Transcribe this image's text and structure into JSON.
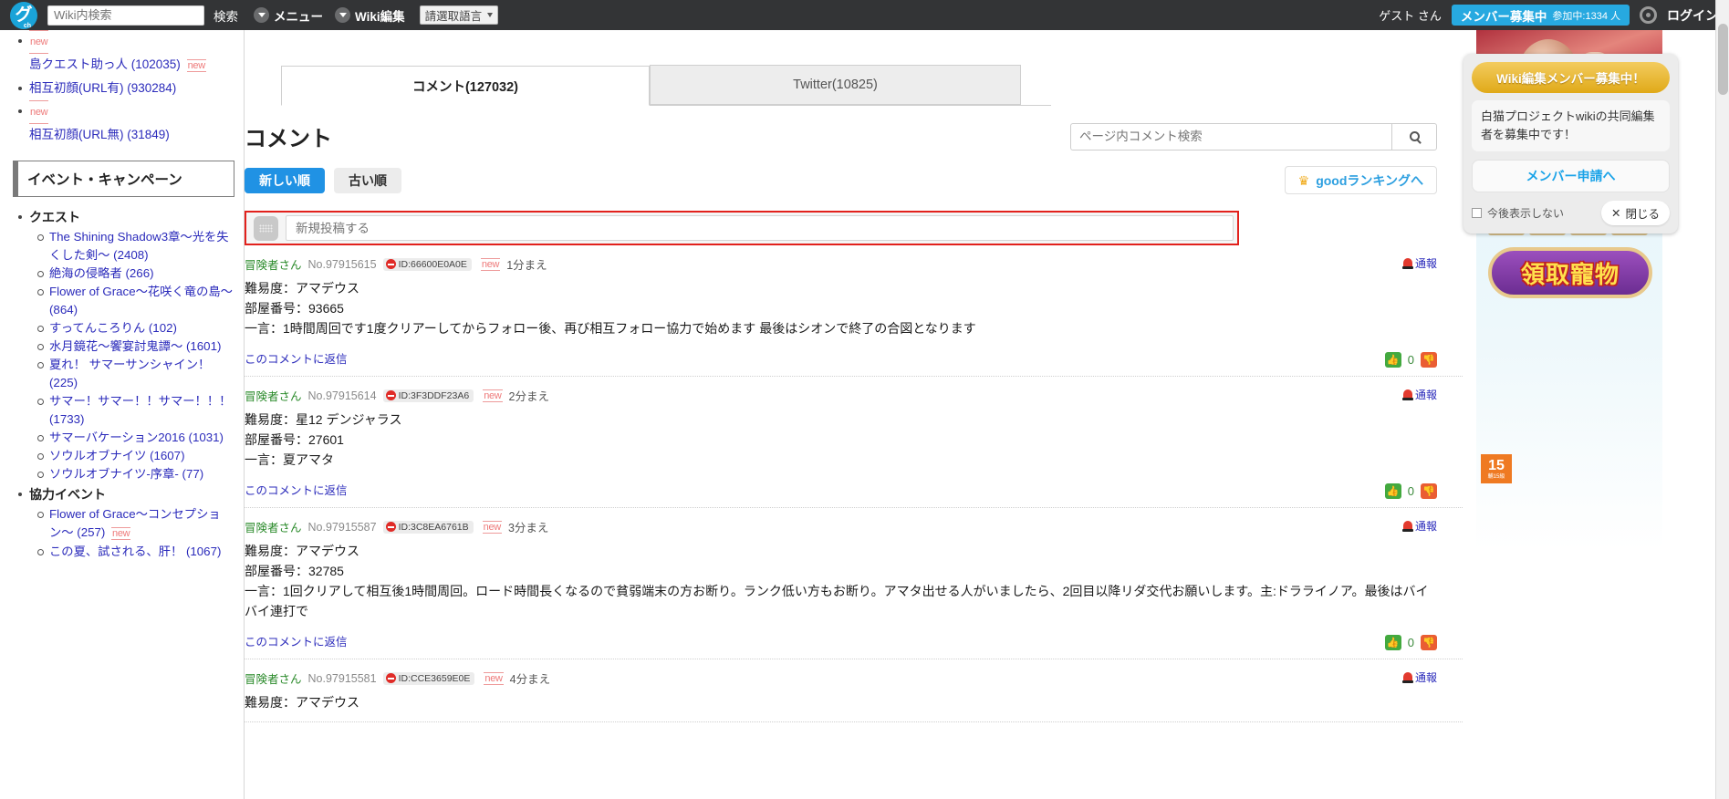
{
  "topbar": {
    "logo_text": "グ",
    "logo_sub": "ch",
    "search_placeholder": "Wiki内検索",
    "search_value": "",
    "search_button": "検索",
    "menu_label": "メニュー",
    "wiki_edit_label": "Wiki編集",
    "language_selected": "請選取語言",
    "guest_label": "ゲスト さん",
    "member_badge_title": "メンバー募集中",
    "member_badge_count": "参加中:1334 人",
    "login_label": "ログイン",
    "icons": {
      "menu_caret": "chevron-down-icon",
      "wiki_caret": "chevron-down-icon",
      "gear": "gear-icon"
    }
  },
  "sidebar": {
    "top_links": [
      {
        "label": "島クエスト助っ人 (102035)",
        "new_before": true,
        "new_after": true
      },
      {
        "label": "相互初顔(URL有) (930284)",
        "new_before": false,
        "new_after": false
      },
      {
        "label": "相互初顔(URL無) (31849)",
        "new_before": true,
        "new_after": false
      }
    ],
    "heading": "イベント・キャンペーン",
    "groups": [
      {
        "title": "クエスト",
        "items": [
          {
            "label": "The Shining Shadow3章〜光を失くした剣〜 (2408)",
            "new": false
          },
          {
            "label": "絶海の侵略者 (266)",
            "new": false
          },
          {
            "label": "Flower of Grace〜花咲く竜の島〜 (864)",
            "new": false
          },
          {
            "label": "すってんころりん (102)",
            "new": false
          },
          {
            "label": "水月鏡花〜饗宴討鬼譚〜 (1601)",
            "new": false
          },
          {
            "label": "夏れ！ サマーサンシャイン！ (225)",
            "new": false
          },
          {
            "label": "サマー！サマー！！サマー！！！ (1733)",
            "new": false
          },
          {
            "label": "サマーバケーション2016 (1031)",
            "new": false
          },
          {
            "label": "ソウルオブナイツ (1607)",
            "new": false
          },
          {
            "label": "ソウルオブナイツ-序章- (77)",
            "new": false
          }
        ]
      },
      {
        "title": "協力イベント",
        "items": [
          {
            "label": "Flower of Grace〜コンセプション〜 (257)",
            "new": true
          },
          {
            "label": "この夏、試される、肝！ (1067)",
            "new": false
          }
        ]
      }
    ]
  },
  "main": {
    "tabs": [
      {
        "label": "コメント(127032)",
        "active": true
      },
      {
        "label": "Twitter(10825)",
        "active": false
      }
    ],
    "section_title": "コメント",
    "search_placeholder": "ページ内コメント検索",
    "search_value": "",
    "sort_new": "新しい順",
    "sort_old": "古い順",
    "good_ranking": "goodランキングへ",
    "post_placeholder": "新規投稿する",
    "post_value": "",
    "report_label": "通報",
    "reply_label": "このコメントに返信",
    "comments": [
      {
        "author": "冒険者さん",
        "number": "No.97915615",
        "user_id": "ID:66600E0A0E",
        "new": "new",
        "time": "1分まえ",
        "lines": [
          "難易度：アマデウス",
          "部屋番号：93665",
          "一言：1時間周回です1度クリアーしてからフォロー後、再び相互フォロー協力で始めます 最後はシオンで終了の合図となります"
        ],
        "vote_count": "0"
      },
      {
        "author": "冒険者さん",
        "number": "No.97915614",
        "user_id": "ID:3F3DDF23A6",
        "new": "new",
        "time": "2分まえ",
        "lines": [
          "難易度：星12 デンジャラス",
          "部屋番号：27601",
          "一言：夏アマタ"
        ],
        "vote_count": "0"
      },
      {
        "author": "冒険者さん",
        "number": "No.97915587",
        "user_id": "ID:3C8EA6761B",
        "new": "new",
        "time": "3分まえ",
        "lines": [
          "難易度：アマデウス",
          "部屋番号：32785",
          "一言：1回クリアして相互後1時間周回。ロード時間長くなるので貧弱端末の方お断り。ランク低い方もお断り。アマタ出せる人がいましたら、2回目以降リダ交代お願いします。主:ドラライノア。最後はバイバイ連打で"
        ],
        "vote_count": "0"
      },
      {
        "author": "冒険者さん",
        "number": "No.97915581",
        "user_id": "ID:CCE3659E0E",
        "new": "new",
        "time": "4分まえ",
        "lines": [
          "難易度：アマデウス"
        ],
        "vote_count": "0"
      }
    ]
  },
  "wikibox": {
    "title": "Wiki編集メンバー募集中！",
    "body": "白猫プロジェクトwikiの共同編集者を募集中です！",
    "apply": "メンバー申請へ",
    "dont_show": "今後表示しない",
    "close": "閉じる"
  },
  "ad": {
    "button_text": "領取寵物",
    "rating": "15",
    "rating_sub": "輔15級"
  },
  "colors": {
    "accent_blue": "#2092e4",
    "topbar": "#333436",
    "link": "#2b2bbb",
    "author_green": "#2a8a2a",
    "new_red": "#ee7a7a",
    "gold": "#e0a918",
    "post_border": "#e2211c"
  }
}
